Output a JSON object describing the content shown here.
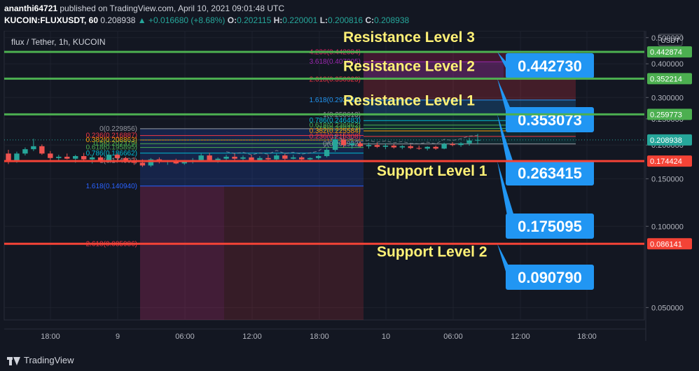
{
  "header": {
    "user": "ananthi64721",
    "published": " published on TradingView.com, April 10, 2021 09:01:48 UTC",
    "symbol": "KUCOIN:FLUXUSDT, 60",
    "last": "0.208938",
    "change_arrow": "▲",
    "change": "+0.016680 (+8.68%)",
    "o_label": "O:",
    "o": "0.202115",
    "h_label": "H:",
    "h": "0.220001",
    "l_label": "L:",
    "l": "0.200816",
    "c_label": "C:",
    "c": "0.208938"
  },
  "footer": {
    "brand": "TradingView"
  },
  "chart_data": {
    "type": "candlestick",
    "title": "flux / Tether, 1h, KUCOIN",
    "currency": "USDT",
    "y_scale": "log",
    "ylim": [
      0.045,
      0.53
    ],
    "yticks": [
      "0.500000",
      "0.400000",
      "0.300000",
      "0.250000",
      "0.200000",
      "0.150000",
      "0.100000",
      "0.050000"
    ],
    "yticks_values": [
      0.5,
      0.4,
      0.3,
      0.25,
      0.2,
      0.15,
      0.1,
      0.05
    ],
    "xticks": [
      "18:00",
      "9",
      "06:00",
      "12:00",
      "18:00",
      "10",
      "06:00",
      "12:00",
      "18:00"
    ],
    "horizontal_lines": [
      {
        "label": "Resistance Level 3",
        "value": 0.442874,
        "axis_label": "0.442874",
        "callout": "0.442730",
        "color": "#4caf50"
      },
      {
        "label": "Resistance Level 2",
        "value": 0.352214,
        "axis_label": "0.352214",
        "callout": "0.353073",
        "color": "#4caf50"
      },
      {
        "label": "Resistance Level 1",
        "value": 0.259773,
        "axis_label": "0.259773",
        "callout": "0.263415",
        "color": "#4caf50"
      },
      {
        "label": "Support Level 1",
        "value": 0.174424,
        "axis_label": "0.174424",
        "callout": "0.175095",
        "color": "#f44336"
      },
      {
        "label": "Support Level 2",
        "value": 0.086141,
        "axis_label": "0.086141",
        "callout": "0.090790",
        "color": "#f44336"
      }
    ],
    "current_price": {
      "value": 0.208938,
      "axis_label": "0.208938"
    },
    "fib_left": [
      {
        "text": "0(0.229856)",
        "value": 0.229856,
        "color": "#9598a1"
      },
      {
        "text": "0.236(0.216887)",
        "value": 0.216887,
        "color": "#f23645"
      },
      {
        "text": "0.382(0.208863)",
        "value": 0.208863,
        "color": "#ff9800"
      },
      {
        "text": "0.5(0.202379)",
        "value": 0.202379,
        "color": "#4caf50"
      },
      {
        "text": "0.618(0.195895)",
        "value": 0.195895,
        "color": "#4caf50"
      },
      {
        "text": "0.786(0.186662)",
        "value": 0.186662,
        "color": "#00bcd4"
      },
      {
        "text": "1(0.174902)",
        "value": 0.174902,
        "color": "#9598a1"
      },
      {
        "text": "1.618(0.140940)",
        "value": 0.14094,
        "color": "#2962ff"
      },
      {
        "text": "2.618(0.085986)",
        "value": 0.085986,
        "color": "#f23645"
      }
    ],
    "fib_right": [
      {
        "text": "4.236(0.442034)",
        "value": 0.442034,
        "color": "#e91e63"
      },
      {
        "text": "3.618(0.407005)",
        "value": 0.407005,
        "color": "#9c27b0"
      },
      {
        "text": "2.618(0.350323)",
        "value": 0.350323,
        "color": "#f23645"
      },
      {
        "text": "1.618(0.293642)",
        "value": 0.293642,
        "color": "#2196f3"
      },
      {
        "text": "1(0.258613)",
        "value": 0.258613,
        "color": "#9598a1"
      },
      {
        "text": "0.786(0.246483)",
        "value": 0.246483,
        "color": "#00bcd4"
      },
      {
        "text": "0.618(0.236962)",
        "value": 0.236962,
        "color": "#4caf50"
      },
      {
        "text": "0.5(0.230273)",
        "value": 0.230273,
        "color": "#4caf50"
      },
      {
        "text": "0.382(0.225584)",
        "value": 0.225584,
        "color": "#ff9800"
      },
      {
        "text": "0.236(0.215308)",
        "value": 0.215308,
        "color": "#f23645"
      },
      {
        "text": "0(0.201932)",
        "value": 0.201932,
        "color": "#9598a1"
      }
    ],
    "candles": [
      {
        "o": 0.186,
        "h": 0.192,
        "l": 0.17,
        "c": 0.175
      },
      {
        "o": 0.175,
        "h": 0.189,
        "l": 0.172,
        "c": 0.186
      },
      {
        "o": 0.186,
        "h": 0.196,
        "l": 0.183,
        "c": 0.193
      },
      {
        "o": 0.193,
        "h": 0.211,
        "l": 0.19,
        "c": 0.198
      },
      {
        "o": 0.198,
        "h": 0.201,
        "l": 0.184,
        "c": 0.186
      },
      {
        "o": 0.186,
        "h": 0.19,
        "l": 0.176,
        "c": 0.179
      },
      {
        "o": 0.179,
        "h": 0.184,
        "l": 0.174,
        "c": 0.181
      },
      {
        "o": 0.181,
        "h": 0.186,
        "l": 0.177,
        "c": 0.178
      },
      {
        "o": 0.178,
        "h": 0.184,
        "l": 0.172,
        "c": 0.182
      },
      {
        "o": 0.182,
        "h": 0.187,
        "l": 0.175,
        "c": 0.177
      },
      {
        "o": 0.177,
        "h": 0.184,
        "l": 0.171,
        "c": 0.18
      },
      {
        "o": 0.18,
        "h": 0.183,
        "l": 0.172,
        "c": 0.174
      },
      {
        "o": 0.174,
        "h": 0.188,
        "l": 0.172,
        "c": 0.184
      },
      {
        "o": 0.184,
        "h": 0.186,
        "l": 0.176,
        "c": 0.179
      },
      {
        "o": 0.179,
        "h": 0.181,
        "l": 0.172,
        "c": 0.175
      },
      {
        "o": 0.175,
        "h": 0.18,
        "l": 0.169,
        "c": 0.172
      },
      {
        "o": 0.172,
        "h": 0.177,
        "l": 0.166,
        "c": 0.168
      },
      {
        "o": 0.168,
        "h": 0.179,
        "l": 0.166,
        "c": 0.177
      },
      {
        "o": 0.177,
        "h": 0.18,
        "l": 0.171,
        "c": 0.173
      },
      {
        "o": 0.173,
        "h": 0.176,
        "l": 0.169,
        "c": 0.175
      },
      {
        "o": 0.175,
        "h": 0.178,
        "l": 0.17,
        "c": 0.171
      },
      {
        "o": 0.171,
        "h": 0.176,
        "l": 0.169,
        "c": 0.174
      },
      {
        "o": 0.174,
        "h": 0.179,
        "l": 0.171,
        "c": 0.176
      },
      {
        "o": 0.176,
        "h": 0.186,
        "l": 0.174,
        "c": 0.183
      },
      {
        "o": 0.183,
        "h": 0.187,
        "l": 0.174,
        "c": 0.176
      },
      {
        "o": 0.176,
        "h": 0.18,
        "l": 0.172,
        "c": 0.178
      },
      {
        "o": 0.178,
        "h": 0.184,
        "l": 0.176,
        "c": 0.181
      },
      {
        "o": 0.181,
        "h": 0.186,
        "l": 0.176,
        "c": 0.178
      },
      {
        "o": 0.178,
        "h": 0.183,
        "l": 0.174,
        "c": 0.18
      },
      {
        "o": 0.18,
        "h": 0.184,
        "l": 0.174,
        "c": 0.176
      },
      {
        "o": 0.176,
        "h": 0.182,
        "l": 0.173,
        "c": 0.179
      },
      {
        "o": 0.179,
        "h": 0.184,
        "l": 0.176,
        "c": 0.177
      },
      {
        "o": 0.177,
        "h": 0.186,
        "l": 0.175,
        "c": 0.183
      },
      {
        "o": 0.183,
        "h": 0.186,
        "l": 0.176,
        "c": 0.178
      },
      {
        "o": 0.178,
        "h": 0.184,
        "l": 0.177,
        "c": 0.18
      },
      {
        "o": 0.18,
        "h": 0.182,
        "l": 0.174,
        "c": 0.177
      },
      {
        "o": 0.177,
        "h": 0.18,
        "l": 0.175,
        "c": 0.179
      },
      {
        "o": 0.179,
        "h": 0.184,
        "l": 0.177,
        "c": 0.182
      },
      {
        "o": 0.182,
        "h": 0.195,
        "l": 0.18,
        "c": 0.192
      },
      {
        "o": 0.192,
        "h": 0.216,
        "l": 0.189,
        "c": 0.21
      },
      {
        "o": 0.21,
        "h": 0.221,
        "l": 0.196,
        "c": 0.2
      },
      {
        "o": 0.2,
        "h": 0.208,
        "l": 0.194,
        "c": 0.203
      },
      {
        "o": 0.203,
        "h": 0.206,
        "l": 0.196,
        "c": 0.198
      },
      {
        "o": 0.198,
        "h": 0.204,
        "l": 0.194,
        "c": 0.2
      },
      {
        "o": 0.2,
        "h": 0.204,
        "l": 0.195,
        "c": 0.197
      },
      {
        "o": 0.197,
        "h": 0.203,
        "l": 0.193,
        "c": 0.199
      },
      {
        "o": 0.199,
        "h": 0.202,
        "l": 0.194,
        "c": 0.196
      },
      {
        "o": 0.196,
        "h": 0.2,
        "l": 0.193,
        "c": 0.198
      },
      {
        "o": 0.198,
        "h": 0.201,
        "l": 0.193,
        "c": 0.195
      },
      {
        "o": 0.195,
        "h": 0.199,
        "l": 0.192,
        "c": 0.194
      },
      {
        "o": 0.194,
        "h": 0.198,
        "l": 0.191,
        "c": 0.197
      },
      {
        "o": 0.197,
        "h": 0.199,
        "l": 0.192,
        "c": 0.194
      },
      {
        "o": 0.194,
        "h": 0.204,
        "l": 0.193,
        "c": 0.202
      },
      {
        "o": 0.202,
        "h": 0.205,
        "l": 0.198,
        "c": 0.2
      },
      {
        "o": 0.2,
        "h": 0.205,
        "l": 0.197,
        "c": 0.203
      },
      {
        "o": 0.203,
        "h": 0.213,
        "l": 0.199,
        "c": 0.208
      },
      {
        "o": 0.208,
        "h": 0.22,
        "l": 0.201,
        "c": 0.209
      }
    ]
  }
}
